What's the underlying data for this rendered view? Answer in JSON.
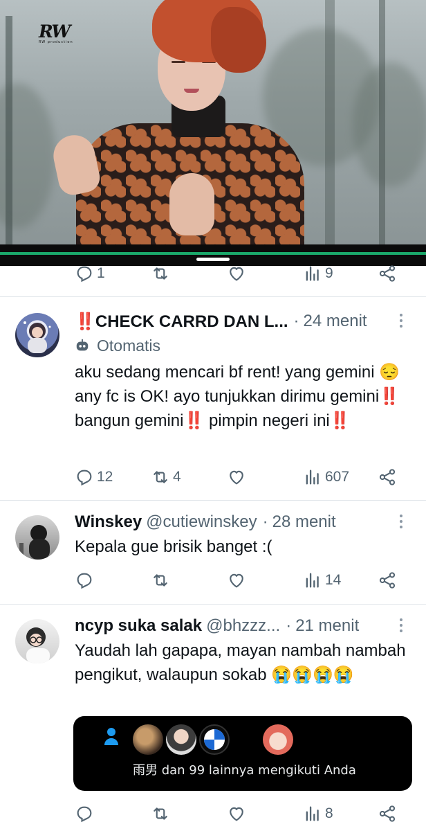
{
  "video": {
    "logo_mark": "RW",
    "logo_sub": "RW production"
  },
  "top_actions": {
    "reply_count": "1",
    "retweet_count": "",
    "views_count": "9"
  },
  "tweets": [
    {
      "name": "‼️CHECK CARRD DAN L...",
      "handle": "",
      "time": "24 menit",
      "label": "Otomatis",
      "text": "aku sedang mencari bf rent! yang gemini 😔 any fc is OK! ayo tunjukkan dirimu gemini‼️ bangun gemini‼️ pimpin negeri ini‼️",
      "reply_count": "12",
      "retweet_count": "4",
      "views_count": "607"
    },
    {
      "name": "Winskey",
      "handle": "@cutiewinskey",
      "time": "28 menit",
      "text": "Kepala gue brisik banget :(",
      "reply_count": "",
      "retweet_count": "",
      "views_count": "14"
    },
    {
      "name": "ncyp suka salak",
      "handle": "@bhzzz...",
      "time": "21 menit",
      "text": "Yaudah lah gapapa, mayan nambah nambah pengikut, walaupun sokab 😭😭😭😭",
      "toast_text": "雨男 dan 99 lainnya mengikuti Anda",
      "reply_count": "",
      "retweet_count": "",
      "views_count": "8"
    }
  ],
  "colors": {
    "accent_green": "#1aa86a",
    "muted": "#536471",
    "divider": "#e1e6ea",
    "person_blue": "#1d9bf0"
  }
}
